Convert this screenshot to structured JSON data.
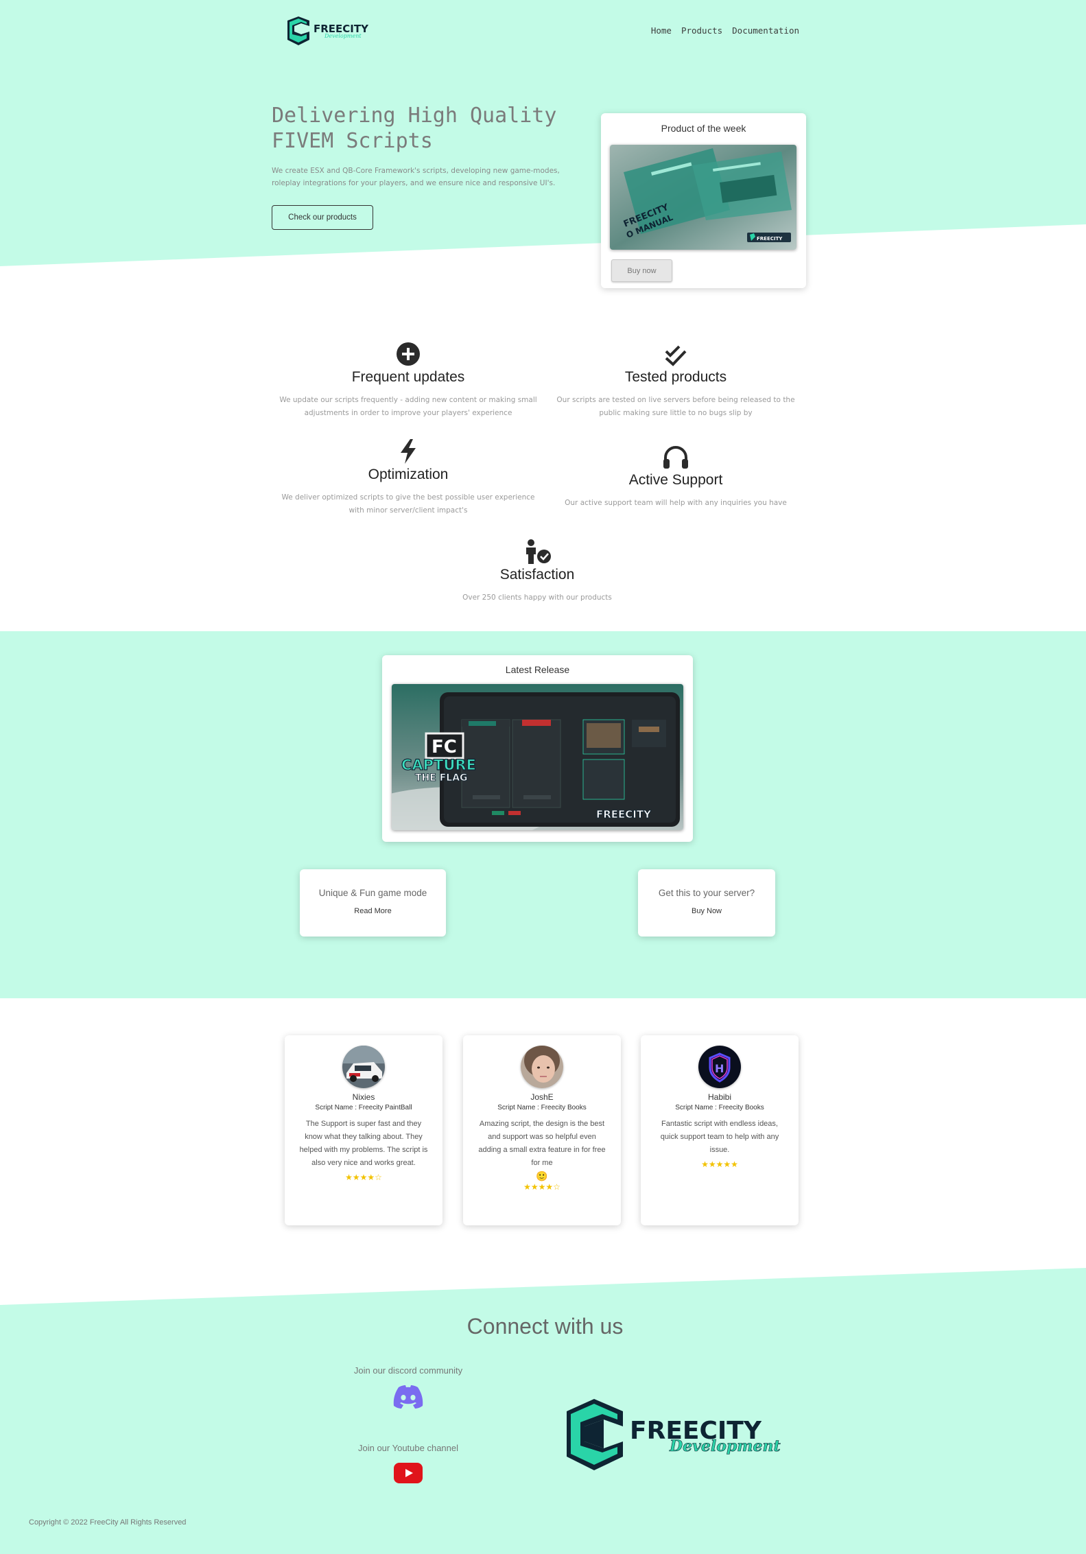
{
  "nav": {
    "logo_main": "FREECITY",
    "logo_sub": "Development",
    "links": [
      "Home",
      "Products",
      "Documentation"
    ]
  },
  "hero": {
    "title": "Delivering High Quality FIVEM Scripts",
    "text": "We create ESX and QB-Core Framework's scripts, developing new game-modes, roleplay integrations for your players, and we ensure nice and responsive UI's.",
    "button": "Check our products"
  },
  "product_of_week": {
    "title": "Product of the week",
    "image_caption_1": "FREECITY",
    "image_caption_2": "O MANUAL",
    "button": "Buy now"
  },
  "features": [
    {
      "icon": "plus-circle-icon",
      "title": "Frequent updates",
      "text": "We update our scripts frequently - adding new content or making small adjustments in order to improve your players' experience"
    },
    {
      "icon": "double-check-icon",
      "title": "Tested products",
      "text": "Our scripts are tested on live servers before being released to the public making sure little to no bugs slip by"
    },
    {
      "icon": "lightning-bolt-icon",
      "title": "Optimization",
      "text": "We deliver optimized scripts to give the best possible user experience with minor server/client impact's"
    },
    {
      "icon": "headphones-icon",
      "title": "Active Support",
      "text": "Our active support team will help with any inquiries you have"
    },
    {
      "icon": "person-check-icon",
      "title": "Satisfaction",
      "text": "Over 250 clients happy with our products"
    }
  ],
  "latest_release": {
    "title": "Latest Release",
    "image_fc": "FC",
    "image_title_1": "CAPTURE",
    "image_title_2": "THE FLAG",
    "image_brand": "FREECITY"
  },
  "mini_cards": [
    {
      "title": "Unique & Fun game mode",
      "link": "Read More"
    },
    {
      "title": "Get this to your server?",
      "link": "Buy Now"
    }
  ],
  "testimonials": [
    {
      "name": "Nixies",
      "script": "Script Name : Freecity PaintBall",
      "text": "The Support is super fast and they know what they talking about. They helped with my problems. The script is also very nice and works great.",
      "stars": "★★★★☆",
      "rating": 4
    },
    {
      "name": "JoshE",
      "script": "Script Name : Freecity Books",
      "text": "Amazing script, the design is the best and support was so helpful even adding a small extra feature in for free for me",
      "emoji": "🙂",
      "stars": "★★★★☆",
      "rating": 4
    },
    {
      "name": "Habibi",
      "script": "Script Name : Freecity Books",
      "text": "Fantastic script with endless ideas, quick support team to help with any issue.",
      "stars": "★★★★★",
      "rating": 5
    }
  ],
  "footer": {
    "title": "Connect with us",
    "discord_label": "Join our discord community",
    "youtube_label": "Join our Youtube channel",
    "logo_main": "FREECITY",
    "logo_sub": "Development",
    "copyright": "Copyright © 2022 FreeCity All Rights Reserved"
  },
  "colors": {
    "mint": "#c3fbe7",
    "brand_teal": "#2ad4a8",
    "brand_dark": "#0e2433",
    "discord": "#7a6cf0",
    "youtube": "#e0141b",
    "stars": "#f2c200"
  }
}
